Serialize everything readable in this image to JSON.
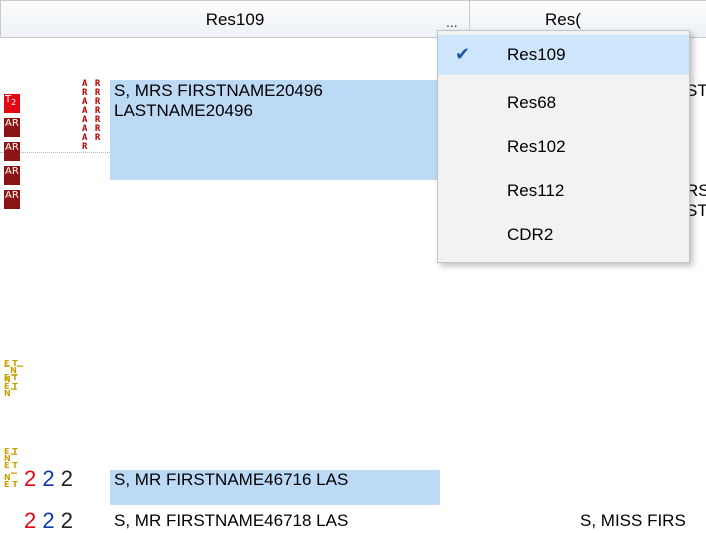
{
  "grid": {
    "columns": [
      {
        "title": "Res109"
      },
      {
        "title": "Res("
      }
    ],
    "header_dots": "...",
    "badges": {
      "t2": "T",
      "t2_sub": "2",
      "ar": "AR"
    },
    "rows": [
      {
        "line1": "S, MRS FIRSTNAME20496",
        "line2": "LASTNAME20496",
        "right_clip": "ST"
      },
      {
        "right_clip_1": "RS",
        "right_clip_2": "ST"
      },
      {
        "numbers": [
          "2",
          "2",
          "2"
        ],
        "line1": "S, MR FIRSTNAME46716 LAS"
      },
      {
        "numbers": [
          "2",
          "2",
          "2"
        ],
        "line1": "S, MR FIRSTNAME46718 LAS",
        "right_clip": "S, MISS FIRS"
      }
    ]
  },
  "menu": {
    "items": [
      {
        "label": "Res109",
        "checked": true
      },
      {
        "label": "Res68",
        "checked": false
      },
      {
        "label": "Res102",
        "checked": false
      },
      {
        "label": "Res112",
        "checked": false
      },
      {
        "label": "CDR2",
        "checked": false
      }
    ],
    "check_glyph": "✔"
  },
  "colors": {
    "selection": "#bcdaf6",
    "menu_highlight": "#cde6fb",
    "badge_red": "#e30613",
    "badge_dark": "#8b1414",
    "number_red": "#e30613",
    "number_blue": "#0f3aa8"
  }
}
